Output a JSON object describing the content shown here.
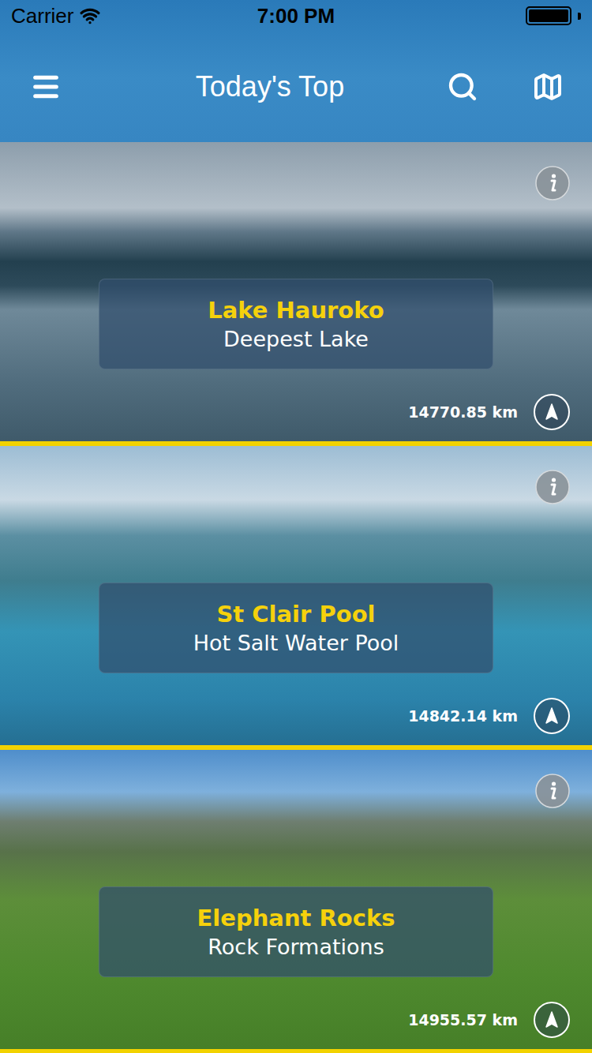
{
  "status_bar": {
    "carrier": "Carrier",
    "time": "7:00 PM",
    "battery": {
      "level": 1
    }
  },
  "nav": {
    "title": "Today's Top"
  },
  "places": [
    {
      "name": "Lake Hauroko",
      "category": "Deepest Lake",
      "distance": "14770.85 km"
    },
    {
      "name": "St Clair Pool",
      "category": "Hot Salt Water Pool",
      "distance": "14842.14 km"
    },
    {
      "name": "Elephant Rocks",
      "category": "Rock Formations",
      "distance": "14955.57 km"
    }
  ]
}
